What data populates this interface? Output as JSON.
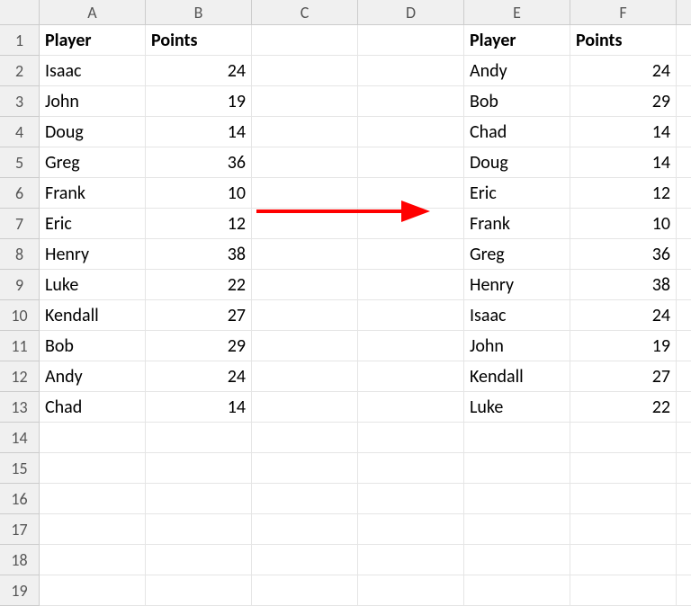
{
  "columns": [
    "A",
    "B",
    "C",
    "D",
    "E",
    "F"
  ],
  "rows": [
    "1",
    "2",
    "3",
    "4",
    "5",
    "6",
    "7",
    "8",
    "9",
    "10",
    "11",
    "12",
    "13",
    "14",
    "15",
    "16",
    "17",
    "18",
    "19"
  ],
  "left_table": {
    "headers": {
      "player": "Player",
      "points": "Points"
    },
    "data": [
      {
        "player": "Isaac",
        "points": 24
      },
      {
        "player": "John",
        "points": 19
      },
      {
        "player": "Doug",
        "points": 14
      },
      {
        "player": "Greg",
        "points": 36
      },
      {
        "player": "Frank",
        "points": 10
      },
      {
        "player": "Eric",
        "points": 12
      },
      {
        "player": "Henry",
        "points": 38
      },
      {
        "player": "Luke",
        "points": 22
      },
      {
        "player": "Kendall",
        "points": 27
      },
      {
        "player": "Bob",
        "points": 29
      },
      {
        "player": "Andy",
        "points": 24
      },
      {
        "player": "Chad",
        "points": 14
      }
    ]
  },
  "right_table": {
    "headers": {
      "player": "Player",
      "points": "Points"
    },
    "data": [
      {
        "player": "Andy",
        "points": 24
      },
      {
        "player": "Bob",
        "points": 29
      },
      {
        "player": "Chad",
        "points": 14
      },
      {
        "player": "Doug",
        "points": 14
      },
      {
        "player": "Eric",
        "points": 12
      },
      {
        "player": "Frank",
        "points": 10
      },
      {
        "player": "Greg",
        "points": 36
      },
      {
        "player": "Henry",
        "points": 38
      },
      {
        "player": "Isaac",
        "points": 24
      },
      {
        "player": "John",
        "points": 19
      },
      {
        "player": "Kendall",
        "points": 27
      },
      {
        "player": "Luke",
        "points": 22
      }
    ]
  },
  "arrow": {
    "color": "#ff0000"
  }
}
